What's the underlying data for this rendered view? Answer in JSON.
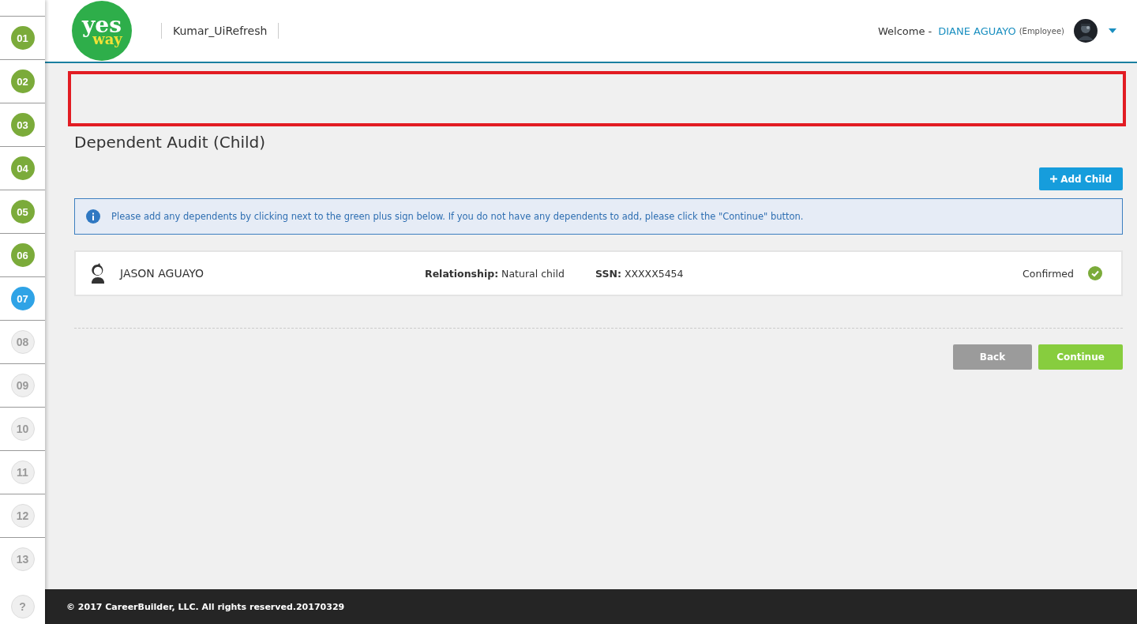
{
  "steps": [
    {
      "number": "01",
      "completed": true,
      "selected": false
    },
    {
      "number": "02",
      "completed": true,
      "selected": false
    },
    {
      "number": "03",
      "completed": true,
      "selected": false
    },
    {
      "number": "04",
      "completed": true,
      "selected": false
    },
    {
      "number": "05",
      "completed": true,
      "selected": false
    },
    {
      "number": "06",
      "completed": true,
      "selected": false
    },
    {
      "number": "07",
      "completed": false,
      "selected": true
    },
    {
      "number": "08",
      "completed": false,
      "selected": false
    },
    {
      "number": "09",
      "completed": false,
      "selected": false
    },
    {
      "number": "10",
      "completed": false,
      "selected": false
    },
    {
      "number": "11",
      "completed": false,
      "selected": false
    },
    {
      "number": "12",
      "completed": false,
      "selected": false
    },
    {
      "number": "13",
      "completed": false,
      "selected": false
    }
  ],
  "help": "?",
  "header": {
    "logo": {
      "top": "yes",
      "bottom": "way"
    },
    "company": "Kumar_UiRefresh",
    "welcome": "Welcome -",
    "user_name": "DIANE AGUAYO",
    "user_role": "(Employee)"
  },
  "page": {
    "title": "Dependent Audit (Child)",
    "add_button": "Add Child",
    "info": "Please add any dependents by clicking next to the green plus sign below.  If you do not have any dependents to add, please click the \"Continue\" button.",
    "dependents": [
      {
        "name": "JASON AGUAYO",
        "relationship_label": "Relationship:",
        "relationship": "Natural child",
        "ssn_label": "SSN:",
        "ssn": "XXXXX5454",
        "status": "Confirmed",
        "confirmed": true
      }
    ],
    "buttons": [
      {
        "label": "Back",
        "kind": "secondary"
      },
      {
        "label": "Continue",
        "kind": "primary"
      }
    ]
  },
  "footer": "© 2017 CareerBuilder, LLC. All rights reserved.20170329"
}
